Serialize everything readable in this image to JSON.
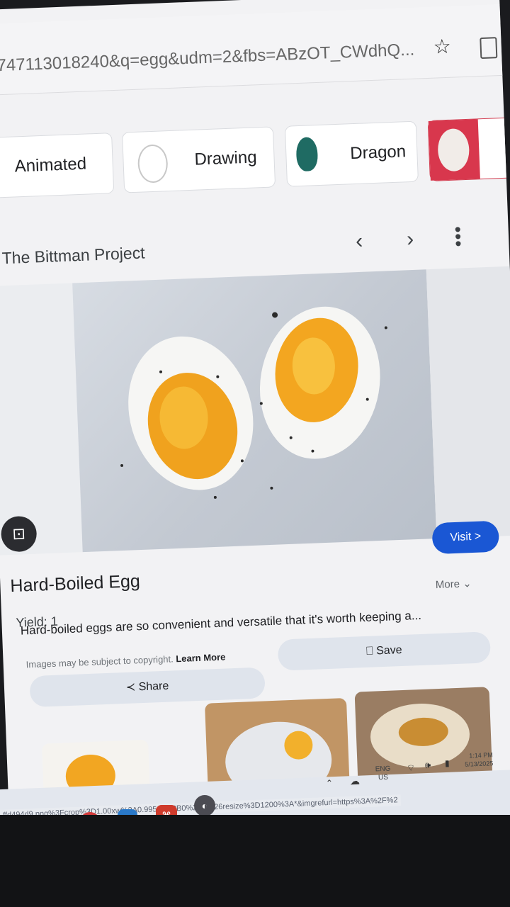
{
  "browser": {
    "url": "1747113018240&q=egg&udm=2&fbs=ABzOT_CWdhQ..."
  },
  "chips": [
    {
      "label": "Animated"
    },
    {
      "label": "Drawing"
    },
    {
      "label": "Dragon"
    }
  ],
  "preview": {
    "source": "The Bittman Project",
    "visit_label": "Visit >",
    "title": "Hard-Boiled Egg",
    "yield": "Yield: 1",
    "description": "Hard-boiled eggs are so convenient and versatile that it's worth keeping a...",
    "more_label": "More",
    "copyright": "Images may be subject to copyright.",
    "learn_more": "Learn More",
    "share_label": "Share",
    "save_label": "Save"
  },
  "status_url": "ffd494d9.png%3Fcrop%3D1.00xw%3A0.995xh%3B0%2C0%26resize%3D1200%3A*&imgrefurl=https%3A%2F%2",
  "tray": {
    "lang_top": "ENG",
    "lang_bottom": "US",
    "time": "1:14 PM",
    "date": "5/13/2025"
  },
  "colors": {
    "visit_button": "#1a57d4",
    "action_button": "#dfe4ec"
  }
}
